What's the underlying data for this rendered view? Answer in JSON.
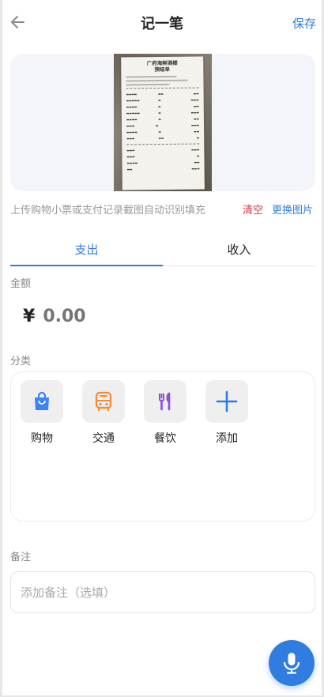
{
  "header": {
    "title": "记一笔",
    "save_label": "保存"
  },
  "receipt_image": {
    "store": "广府海鲜酒楼",
    "doc_title": "预结单"
  },
  "upload": {
    "hint": "上传购物小票或支付记录截图自动识别填充",
    "clear_label": "清空",
    "replace_label": "更换图片"
  },
  "tabs": [
    {
      "label": "支出",
      "active": true
    },
    {
      "label": "收入",
      "active": false
    }
  ],
  "amount": {
    "label": "金额",
    "currency": "¥",
    "placeholder": "0.00"
  },
  "category": {
    "label": "分类",
    "items": [
      {
        "label": "购物",
        "icon": "shopping-bag-icon",
        "color": "#3b82f6"
      },
      {
        "label": "交通",
        "icon": "bus-icon",
        "color": "#f08c3a"
      },
      {
        "label": "餐饮",
        "icon": "fork-knife-icon",
        "color": "#8b4fe0"
      },
      {
        "label": "添加",
        "icon": "plus-icon",
        "color": "#2f7de1"
      }
    ]
  },
  "note": {
    "label": "备注",
    "placeholder": "添加备注（选填）"
  },
  "colors": {
    "accent": "#2f7de1",
    "danger": "#d9363e"
  }
}
